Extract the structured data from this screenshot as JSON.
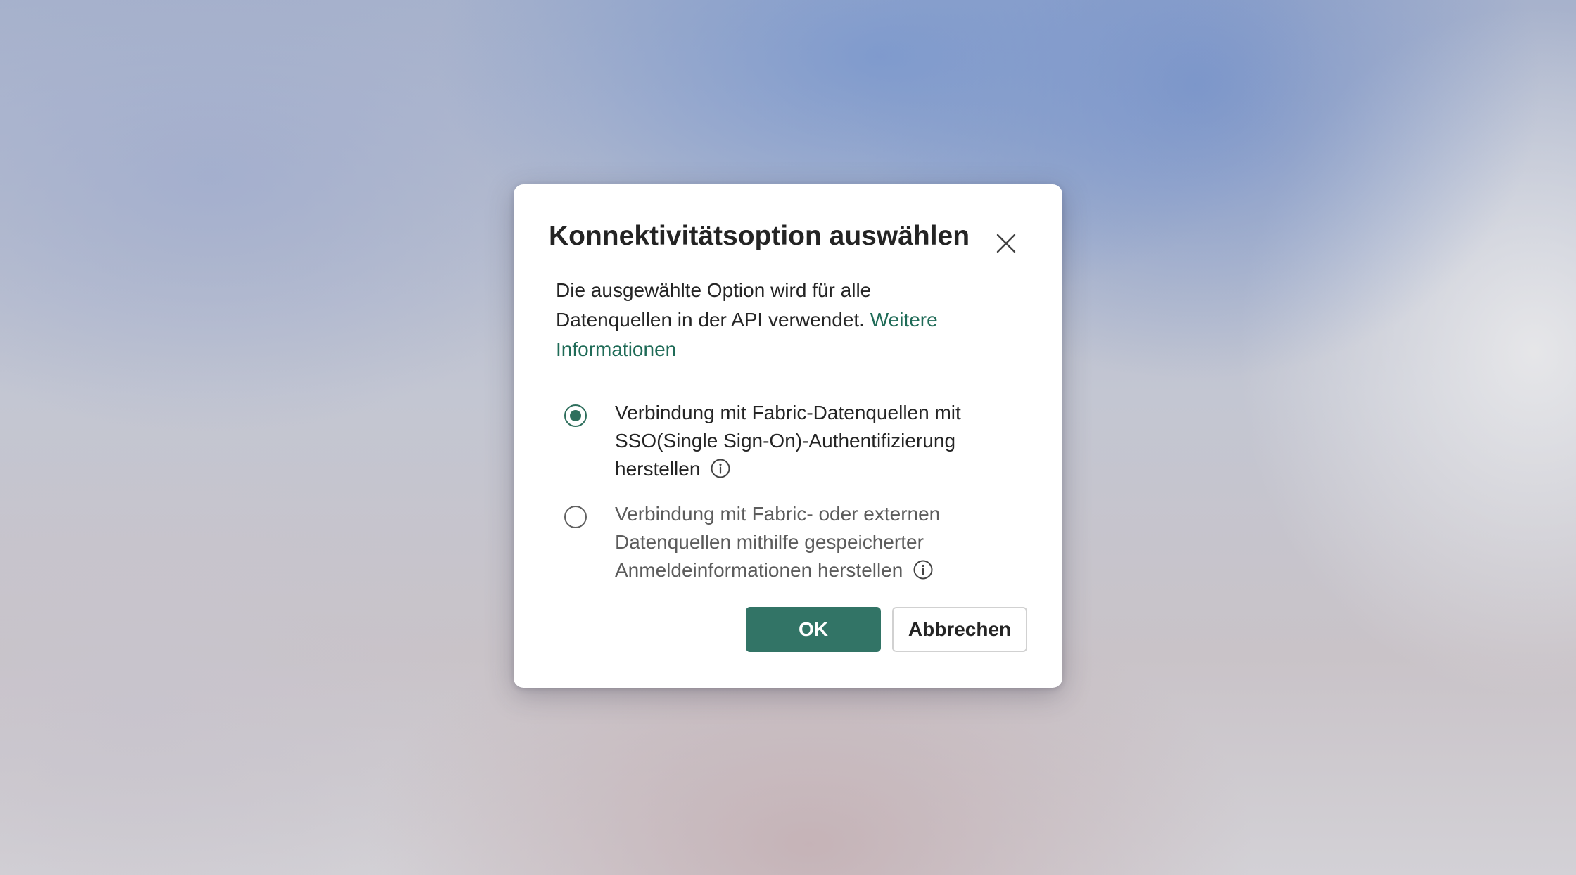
{
  "dialog": {
    "title": "Konnektivitätsoption auswählen",
    "close_icon": "close-icon",
    "description": "Die ausgewählte Option wird für alle Datenquellen in der API verwendet.",
    "learn_more_link": "Weitere Informationen",
    "options": [
      {
        "label": "Verbindung mit Fabric-Datenquellen mit SSO(Single Sign-On)-Authentifizierung herstellen",
        "selected": true,
        "icon": "info-icon"
      },
      {
        "label": "Verbindung mit Fabric- oder externen Datenquellen mithilfe gespeicherter Anmeldeinformationen herstellen",
        "selected": false,
        "icon": "info-icon"
      }
    ],
    "ok_label": "OK",
    "cancel_label": "Abbrechen"
  },
  "colors": {
    "accent": "#327466",
    "link": "#1f6b57",
    "text": "#242424"
  }
}
